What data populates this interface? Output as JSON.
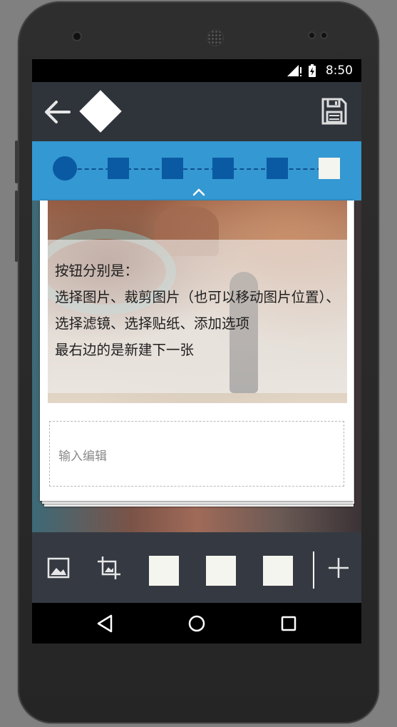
{
  "status_bar": {
    "time": "8:50"
  },
  "toolbar": {
    "back_icon": "arrow-left-icon",
    "logo_icon": "diamond-icon",
    "save_icon": "floppy-disk-icon"
  },
  "stepper": {
    "steps": [
      "circle",
      "square",
      "square",
      "square",
      "square",
      "square-light"
    ],
    "collapse_icon": "chevron-up-icon",
    "colors": {
      "active": "#0a5aa3",
      "background": "#3498d2",
      "final": "#f5f5ef"
    }
  },
  "card": {
    "overlay_lines": [
      "按钮分别是：",
      "选择图片、裁剪图片（也可以移动图片位置）、",
      "选择滤镜、选择贴纸、添加选项",
      "最右边的是新建下一张"
    ],
    "input_placeholder": "输入编辑"
  },
  "bottom_bar": {
    "tools": [
      "image-icon",
      "crop-icon",
      "blank-square",
      "blank-square",
      "blank-square"
    ],
    "add_icon": "plus-icon"
  },
  "nav_bar": {
    "buttons": [
      "back-triangle-icon",
      "home-circle-icon",
      "recents-square-icon"
    ]
  }
}
